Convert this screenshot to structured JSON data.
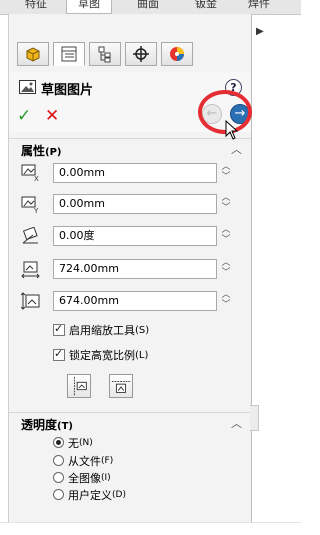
{
  "doc_tabs": [
    "特征",
    "草图",
    "曲面",
    "钣金",
    "焊件"
  ],
  "pm_tabs": [
    "featuremanager-icon",
    "propertymanager-icon",
    "configurationmanager-icon",
    "dimxpert-icon",
    "appearance-icon"
  ],
  "header": {
    "title": "草图图片",
    "help": "?",
    "ok_glyph": "✓",
    "cancel_glyph": "✕",
    "back_glyph": "←",
    "fwd_glyph": "→"
  },
  "properties": {
    "label": "属性",
    "label_accel": "(P)",
    "fields": [
      {
        "icon": "x-position-icon",
        "value": "0.00mm"
      },
      {
        "icon": "y-position-icon",
        "value": "0.00mm"
      },
      {
        "icon": "angle-icon",
        "value": "0.00度"
      },
      {
        "icon": "width-icon",
        "value": "724.00mm"
      },
      {
        "icon": "height-icon",
        "value": "674.00mm"
      }
    ],
    "checks": [
      {
        "label": "启用缩放工具",
        "accel": "(S)",
        "checked": true
      },
      {
        "label": "锁定高宽比例",
        "accel": "(L)",
        "checked": true
      }
    ]
  },
  "transparency": {
    "label": "透明度",
    "label_accel": "(T)",
    "options": [
      {
        "label": "无",
        "accel": "(N)",
        "selected": true
      },
      {
        "label": "从文件",
        "accel": "(F)",
        "selected": false
      },
      {
        "label": "全图像",
        "accel": "(I)",
        "selected": false
      },
      {
        "label": "用户定义",
        "accel": "(D)",
        "selected": false
      }
    ]
  },
  "colors": {
    "accent_red": "#e52d34",
    "nav_blue": "#2a6fb4",
    "ok_green": "#2c9a2c"
  }
}
